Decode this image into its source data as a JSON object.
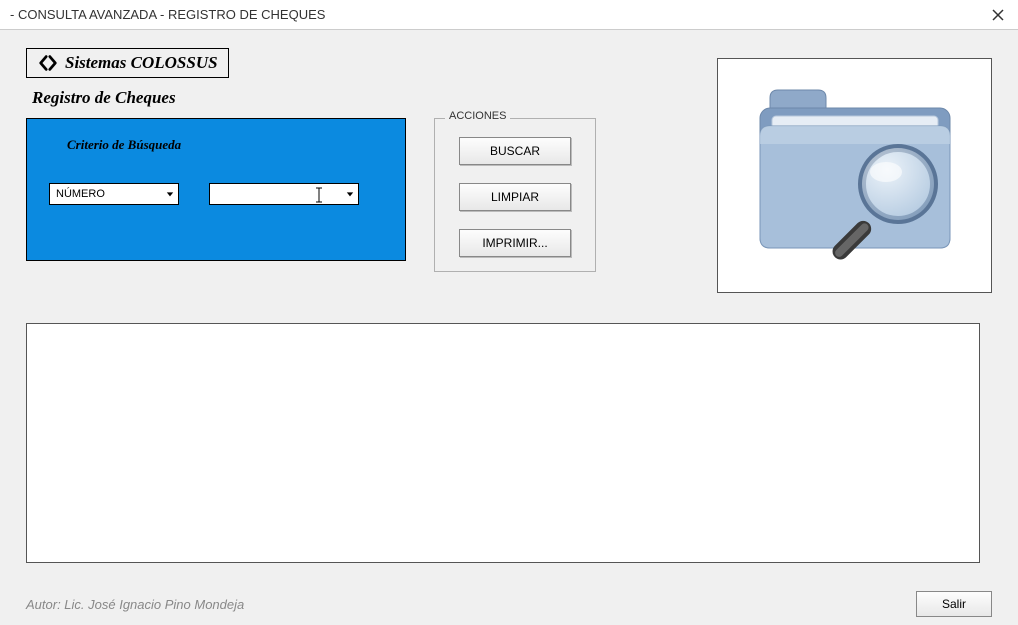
{
  "window": {
    "title": "- CONSULTA AVANZADA - REGISTRO DE CHEQUES"
  },
  "brand": {
    "text": "Sistemas COLOSSUS"
  },
  "page_title": "Registro de Cheques",
  "search": {
    "title": "Criterio de Búsqueda",
    "field_label": "NÚMERO",
    "value": ""
  },
  "actions": {
    "legend": "ACCIONES",
    "buscar": "BUSCAR",
    "limpiar": "LIMPIAR",
    "imprimir": "IMPRIMIR..."
  },
  "footer": {
    "author": "Autor: Lic. José Ignacio Pino Mondeja",
    "salir": "Salir"
  },
  "icons": {
    "folder": "folder-search-icon"
  }
}
